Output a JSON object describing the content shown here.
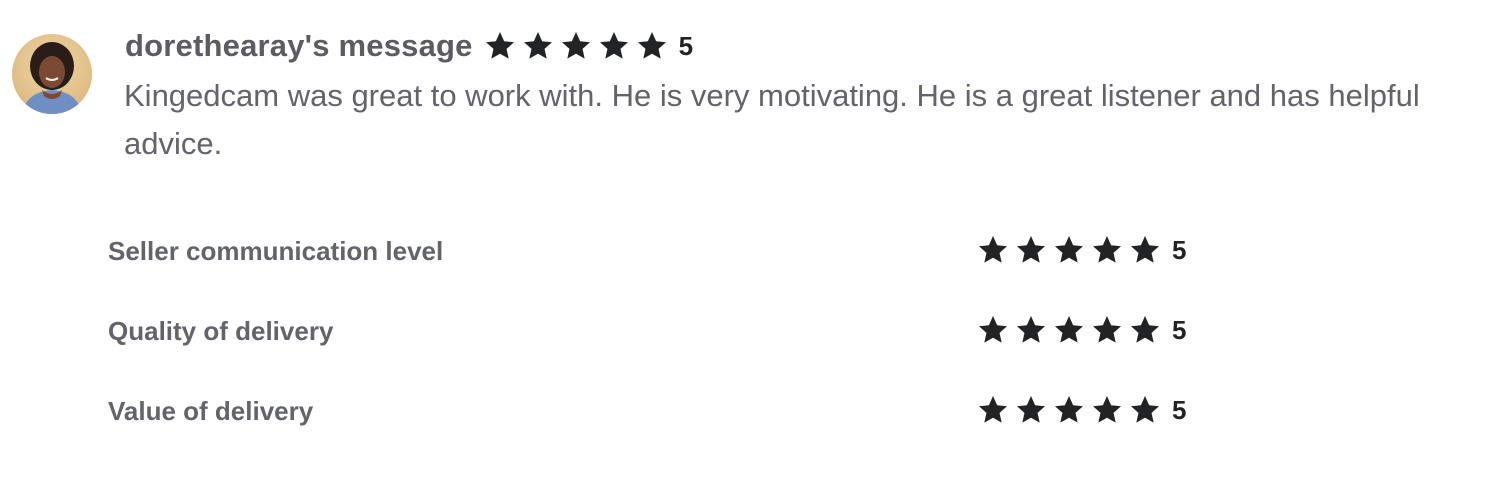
{
  "review": {
    "author": "dorethearay's message",
    "avatar_icon": "user-avatar-photo",
    "overall_rating": "5",
    "message": "Kingedcam was great to work with. He is very motivating. He is a great listener and has helpful advice."
  },
  "breakdown": [
    {
      "label": "Seller communication level",
      "rating": "5"
    },
    {
      "label": "Quality of delivery",
      "rating": "5"
    },
    {
      "label": "Value of delivery",
      "rating": "5"
    }
  ],
  "colors": {
    "star": "#222325",
    "author_text": "#5b5b62",
    "body_text": "#62646a"
  },
  "icons": {
    "star": "star-icon"
  }
}
